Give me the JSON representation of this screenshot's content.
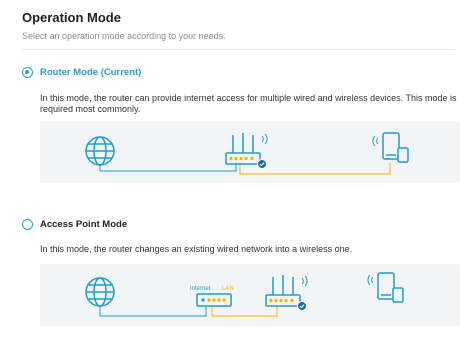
{
  "header": {
    "title": "Operation Mode",
    "subtitle": "Select an operation mode according to your needs."
  },
  "modes": [
    {
      "label": "Router Mode (Current)",
      "selected": true,
      "description": "In this mode, the router can provide internet access for multiple wired and wireless devices. This mode is required most commonly."
    },
    {
      "label": "Access Point Mode",
      "selected": false,
      "description": "In this mode, the router changes an existing wired network into a wireless one.",
      "diagram_labels": {
        "internet": "Internet",
        "lan": "LAN"
      }
    }
  ],
  "colors": {
    "accent": "#2aa5d7",
    "icon_stroke": "#1d9fc7",
    "cable": "#1d9fc7",
    "cable_alt": "#f0b400",
    "diagram_bg": "#f3f4f5"
  },
  "icons": [
    "globe-icon",
    "router-icon",
    "wifi-signal-icon",
    "mobile-devices-icon",
    "modem-icon"
  ]
}
